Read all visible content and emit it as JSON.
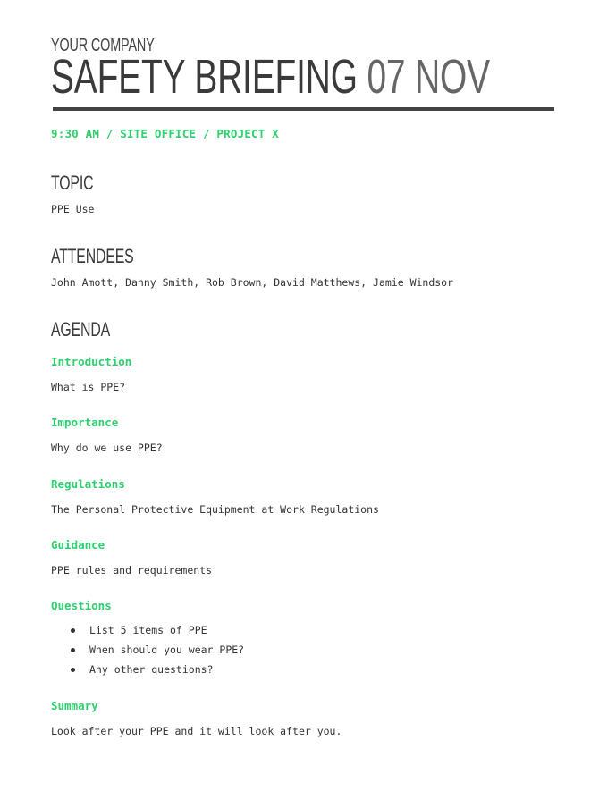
{
  "header": {
    "company": "YOUR COMPANY",
    "title": "SAFETY BRIEFING",
    "date": "07 NOV",
    "meta": "9:30 AM / SITE OFFICE / PROJECT X"
  },
  "topic": {
    "heading": "TOPIC",
    "text": "PPE Use"
  },
  "attendees": {
    "heading": "ATTENDEES",
    "text": "John Amott, Danny Smith, Rob Brown, David Matthews, Jamie Windsor"
  },
  "agenda": {
    "heading": "AGENDA",
    "items": [
      {
        "title": "Introduction",
        "text": "What is PPE?"
      },
      {
        "title": "Importance",
        "text": "Why do we use PPE?"
      },
      {
        "title": "Regulations",
        "text": "The Personal Protective Equipment at Work Regulations"
      },
      {
        "title": "Guidance",
        "text": "PPE rules and requirements"
      },
      {
        "title": "Questions",
        "bullets": [
          "List 5 items of PPE",
          "When should you wear PPE?",
          "Any other questions?"
        ]
      },
      {
        "title": "Summary",
        "text": "Look after your PPE and it will look after you."
      }
    ]
  },
  "colors": {
    "accent": "#2ed06e",
    "heading": "#3a3a3a",
    "rule": "#434343"
  }
}
